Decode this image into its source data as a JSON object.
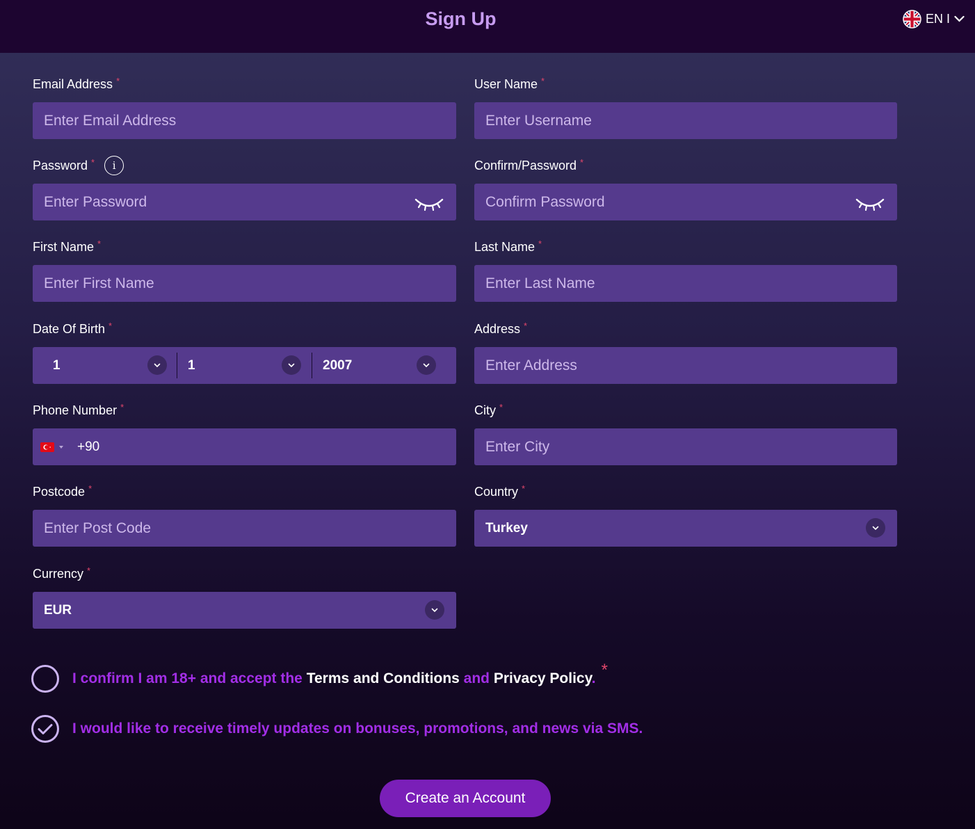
{
  "header": {
    "title": "Sign Up",
    "language": "EN I"
  },
  "fields": {
    "email": {
      "label": "Email Address",
      "placeholder": "Enter Email Address",
      "required": "*"
    },
    "username": {
      "label": "User Name",
      "placeholder": "Enter Username",
      "required": "*"
    },
    "password": {
      "label": "Password",
      "placeholder": "Enter Password",
      "required": "*",
      "info": "i"
    },
    "confirm_password": {
      "label": "Confirm/Password",
      "placeholder": "Confirm Password",
      "required": "*"
    },
    "first_name": {
      "label": "First Name",
      "placeholder": "Enter First Name",
      "required": "*"
    },
    "last_name": {
      "label": "Last Name",
      "placeholder": "Enter Last Name",
      "required": "*"
    },
    "dob": {
      "label": "Date Of Birth",
      "required": "*",
      "day": "1",
      "month": "1",
      "year": "2007"
    },
    "address": {
      "label": "Address",
      "placeholder": "Enter Address",
      "required": "*"
    },
    "phone": {
      "label": "Phone Number",
      "required": "*",
      "code": "+90",
      "flag_icon": "turkey-flag-icon"
    },
    "city": {
      "label": "City",
      "placeholder": "Enter City",
      "required": "*"
    },
    "postcode": {
      "label": "Postcode",
      "placeholder": "Enter Post Code",
      "required": "*"
    },
    "country": {
      "label": "Country",
      "value": "Turkey",
      "required": "*"
    },
    "currency": {
      "label": "Currency",
      "value": "EUR",
      "required": "*"
    }
  },
  "consents": {
    "terms": {
      "part1": "I confirm I am 18+ and accept the ",
      "terms_link": "Terms and Conditions",
      "part2": " and ",
      "privacy_link": "Privacy Policy",
      "part3": ".",
      "required": "*",
      "checked": false
    },
    "sms": {
      "text": "I would like to receive timely updates on bonuses, promotions, and news via SMS.",
      "checked": true
    }
  },
  "submit": {
    "label": "Create an Account"
  },
  "colors": {
    "header_bg": "#1d0530",
    "title": "#c79cf0",
    "input_bg": "#553a8d",
    "placeholder": "#cdb8ea",
    "required": "#e0466b",
    "consent_text": "#a22ee6",
    "button": "#7a1fb8"
  }
}
